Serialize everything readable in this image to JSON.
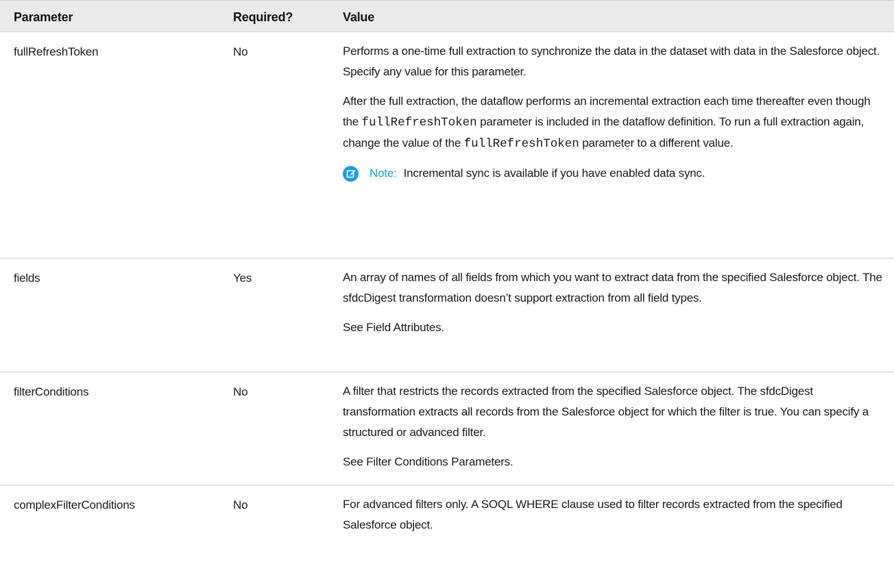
{
  "header": {
    "parameter": "Parameter",
    "required": "Required?",
    "value": "Value"
  },
  "rows": [
    {
      "parameter": "fullRefreshToken",
      "required": "No",
      "p1": "Performs a one-time full extraction to synchronize the data in the dataset with data in the Salesforce object. Specify any value for this parameter.",
      "p2_a": "After the full extraction, the dataflow performs an incremental extraction each time thereafter even though the ",
      "p2_code1": "fullRefreshToken",
      "p2_b": " parameter is included in the dataflow definition. To run a full extraction again, change the value of the ",
      "p2_code2": "fullRefreshToken",
      "p2_c": " parameter to a different value.",
      "note_label": "Note:",
      "note_text": "Incremental sync is available if you have enabled data sync.",
      "note_icon": "edit-note-icon"
    },
    {
      "parameter": "fields",
      "required": "Yes",
      "p1": "An array of names of all fields from which you want to extract data from the specified Salesforce object. The sfdcDigest transformation doesn’t support extraction from all field types.",
      "p2": "See Field Attributes."
    },
    {
      "parameter": "filterConditions",
      "required": "No",
      "p1": "A filter that restricts the records extracted from the specified Salesforce object. The sfdcDigest transformation extracts all records from the Salesforce object for which the filter is true. You can specify a structured or advanced filter.",
      "p2": "See Filter Conditions Parameters."
    },
    {
      "parameter": "complexFilterConditions",
      "required": "No",
      "p1": "For advanced filters only. A SOQL WHERE clause used to filter records extracted from the specified Salesforce object."
    }
  ],
  "colors": {
    "header_bg": "#eaeaea",
    "border": "#cfcfcf",
    "note_accent": "#1b9fe0"
  }
}
